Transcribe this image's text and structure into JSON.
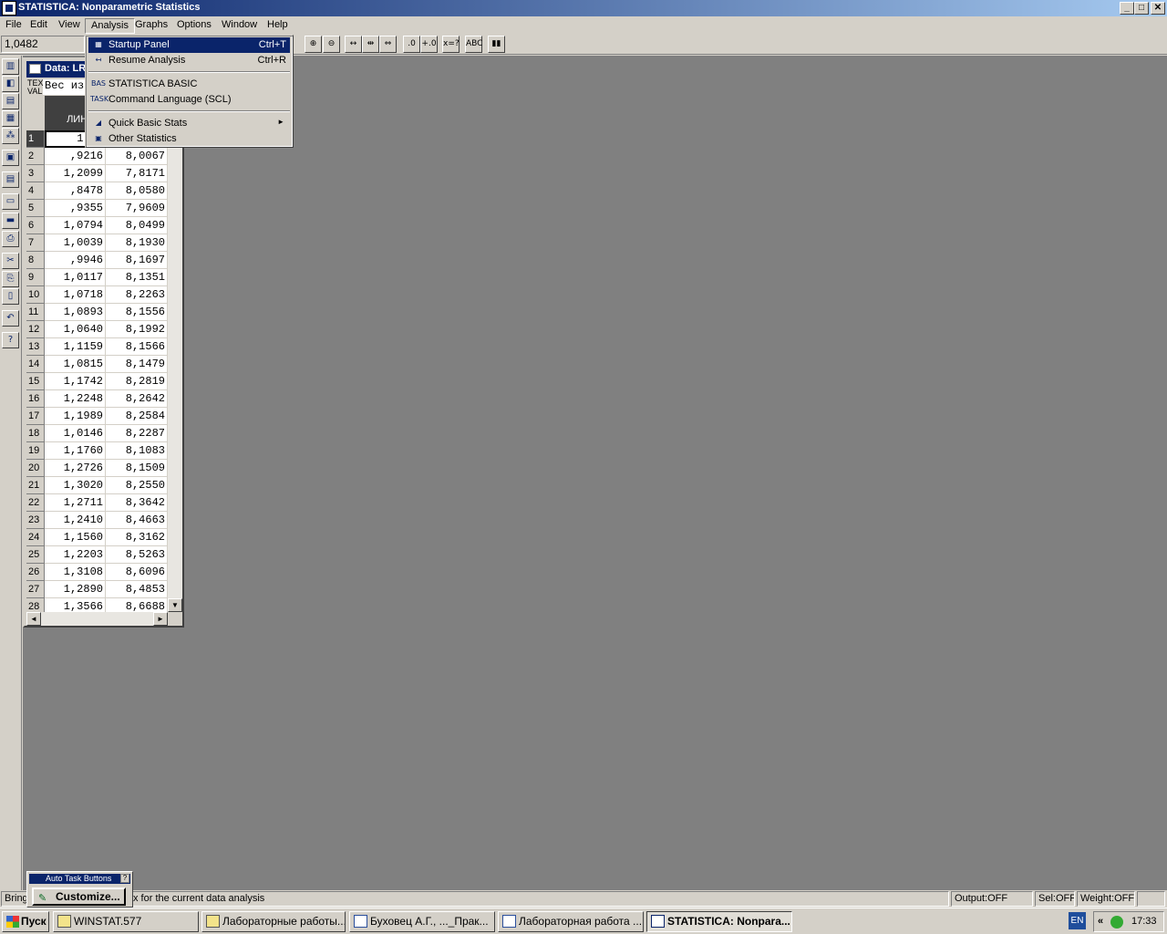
{
  "window": {
    "title": "STATISTICA: Nonparametric Statistics",
    "min": "_",
    "max": "□",
    "close": "✕"
  },
  "menubar": [
    "File",
    "Edit",
    "View",
    "Analysis",
    "Graphs",
    "Options",
    "Window",
    "Help"
  ],
  "toolbar": {
    "cell_value": "1,0482",
    "buttons": [
      "⊕",
      "⊖",
      "↔",
      "⇹",
      "⇔",
      ".0",
      "+.0",
      "x=?",
      "ABC",
      "▮▮"
    ]
  },
  "left_toolbar": [
    "▥",
    "◧",
    "▤",
    "▦",
    "⁂",
    "▣",
    "▤",
    "▭",
    "▬",
    "⎙",
    "✂",
    "⎘",
    "▯",
    "↶",
    "?"
  ],
  "dropdown": {
    "items": [
      {
        "icon": "▦",
        "label": "Startup Panel",
        "shortcut": "Ctrl+T"
      },
      {
        "icon": "↤",
        "label": "Resume Analysis",
        "shortcut": "Ctrl+R"
      },
      {
        "icon": "BAS",
        "label": "STATISTICA BASIC",
        "shortcut": ""
      },
      {
        "icon": "TASK",
        "label": "Command Language (SCL)",
        "shortcut": ""
      },
      {
        "icon": "◢",
        "label": "Quick Basic Stats",
        "shortcut": "",
        "submenu": "►"
      },
      {
        "icon": "▣",
        "label": "Other Statistics",
        "shortcut": ""
      }
    ]
  },
  "datawin": {
    "title": "Data: LR",
    "info_label": "TEX VAL",
    "info_text": "Вес из",
    "columns": [
      {
        "num": "1",
        "name": "ЛИНИЯ"
      },
      {
        "num": "",
        "name": ""
      }
    ],
    "rows": [
      [
        "1",
        "1,04",
        ""
      ],
      [
        "2",
        ",9216",
        "8,0067"
      ],
      [
        "3",
        "1,2099",
        "7,8171"
      ],
      [
        "4",
        ",8478",
        "8,0580"
      ],
      [
        "5",
        ",9355",
        "7,9609"
      ],
      [
        "6",
        "1,0794",
        "8,0499"
      ],
      [
        "7",
        "1,0039",
        "8,1930"
      ],
      [
        "8",
        ",9946",
        "8,1697"
      ],
      [
        "9",
        "1,0117",
        "8,1351"
      ],
      [
        "10",
        "1,0718",
        "8,2263"
      ],
      [
        "11",
        "1,0893",
        "8,1556"
      ],
      [
        "12",
        "1,0640",
        "8,1992"
      ],
      [
        "13",
        "1,1159",
        "8,1566"
      ],
      [
        "14",
        "1,0815",
        "8,1479"
      ],
      [
        "15",
        "1,1742",
        "8,2819"
      ],
      [
        "16",
        "1,2248",
        "8,2642"
      ],
      [
        "17",
        "1,1989",
        "8,2584"
      ],
      [
        "18",
        "1,0146",
        "8,2287"
      ],
      [
        "19",
        "1,1760",
        "8,1083"
      ],
      [
        "20",
        "1,2726",
        "8,1509"
      ],
      [
        "21",
        "1,3020",
        "8,2550"
      ],
      [
        "22",
        "1,2711",
        "8,3642"
      ],
      [
        "23",
        "1,2410",
        "8,4663"
      ],
      [
        "24",
        "1,1560",
        "8,3162"
      ],
      [
        "25",
        "1,2203",
        "8,5263"
      ],
      [
        "26",
        "1,3108",
        "8,6096"
      ],
      [
        "27",
        "1,2890",
        "8,4853"
      ],
      [
        "28",
        "1,3566",
        "8,6688"
      ]
    ]
  },
  "autotask": {
    "title": "Auto Task Buttons",
    "help": "?",
    "customize": "Customize..."
  },
  "statusbar": {
    "left": "Bring",
    "message": "x for the current data analysis",
    "output": "Output:OFF",
    "sel": "Sel:OFF",
    "weight": "Weight:OFF"
  },
  "taskbar": {
    "start": "Пуск",
    "tasks": [
      {
        "label": "WINSTAT.577",
        "kind": "folder"
      },
      {
        "label": "Лабораторные работы...",
        "kind": "folder"
      },
      {
        "label": "Буховец А.Г., ..._Прак...",
        "kind": "word"
      },
      {
        "label": "Лабораторная работа ...",
        "kind": "word"
      },
      {
        "label": "STATISTICA: Nonpara...",
        "kind": "app",
        "active": true
      }
    ],
    "lang": "EN",
    "chevron": "«",
    "clock": "17:33"
  }
}
